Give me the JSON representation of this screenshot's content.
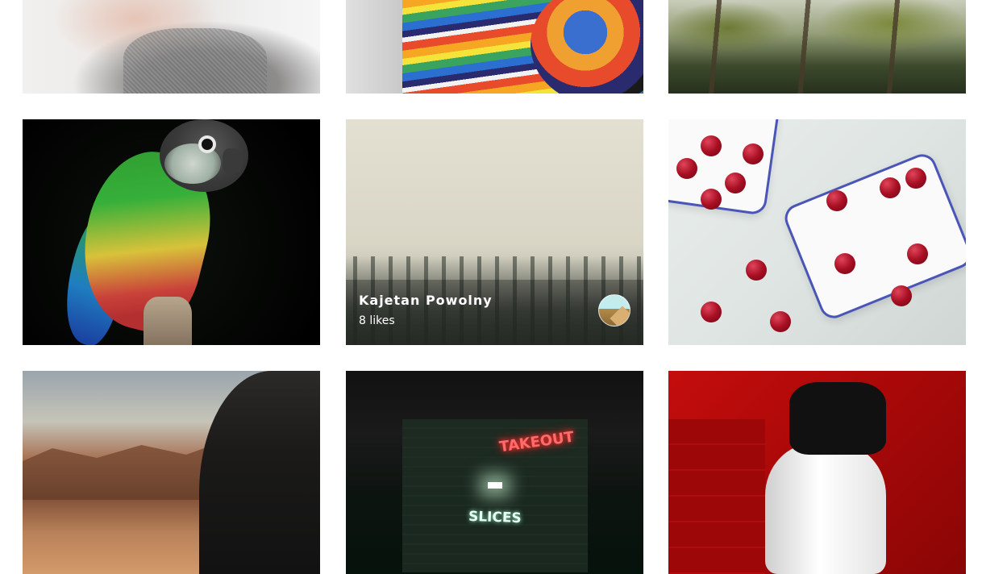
{
  "gallery": {
    "hovered_photo": {
      "author": "Kajetan Powolny",
      "likes": "8 likes"
    },
    "photos": [
      {
        "subject": "person-sweater"
      },
      {
        "subject": "rainbow-striped-shirt"
      },
      {
        "subject": "palm-trees"
      },
      {
        "subject": "parrot"
      },
      {
        "subject": "foggy-forest"
      },
      {
        "subject": "cherries"
      },
      {
        "subject": "desert"
      },
      {
        "subject": "takeout-neon"
      },
      {
        "subject": "red-wall-woman"
      }
    ],
    "neon_signs": {
      "takeout": "TAKEOUT",
      "slices": "SLICES"
    }
  }
}
